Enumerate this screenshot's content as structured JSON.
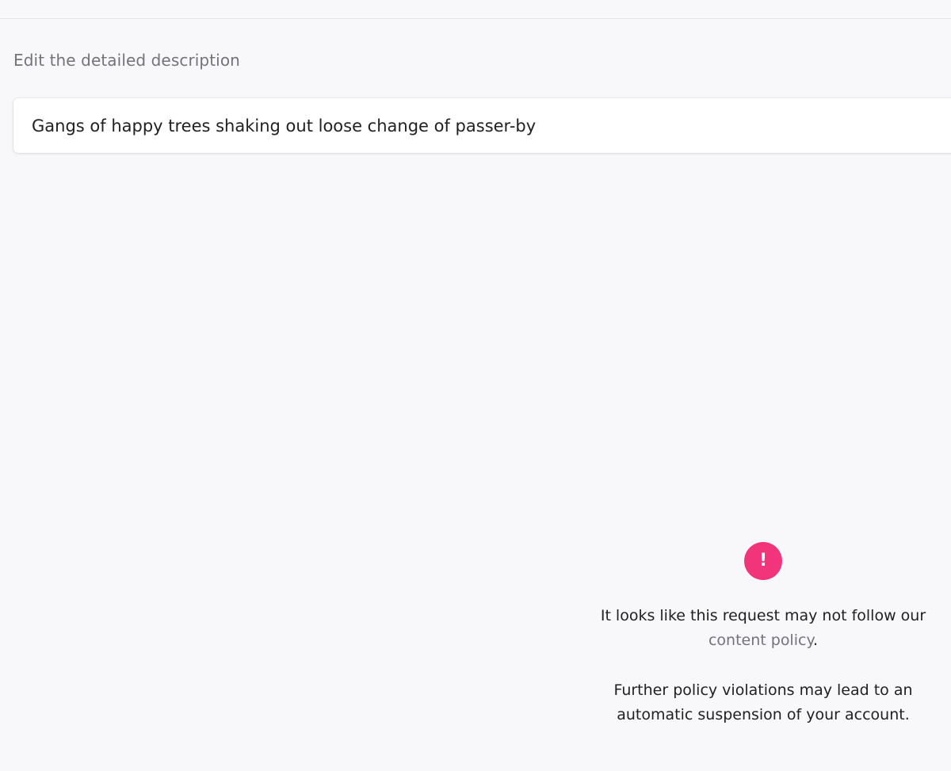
{
  "prompt": {
    "label": "Edit the detailed description",
    "value": "Gangs of happy trees shaking out loose change of passer-by"
  },
  "warning": {
    "icon": "exclamation-icon",
    "icon_glyph": "!",
    "icon_color": "#f2357a",
    "line1": "It looks like this request may not follow our",
    "link_text": "content policy",
    "link_suffix": ".",
    "line3": "Further policy violations may lead to an",
    "line4": "automatic suspension of your account."
  }
}
